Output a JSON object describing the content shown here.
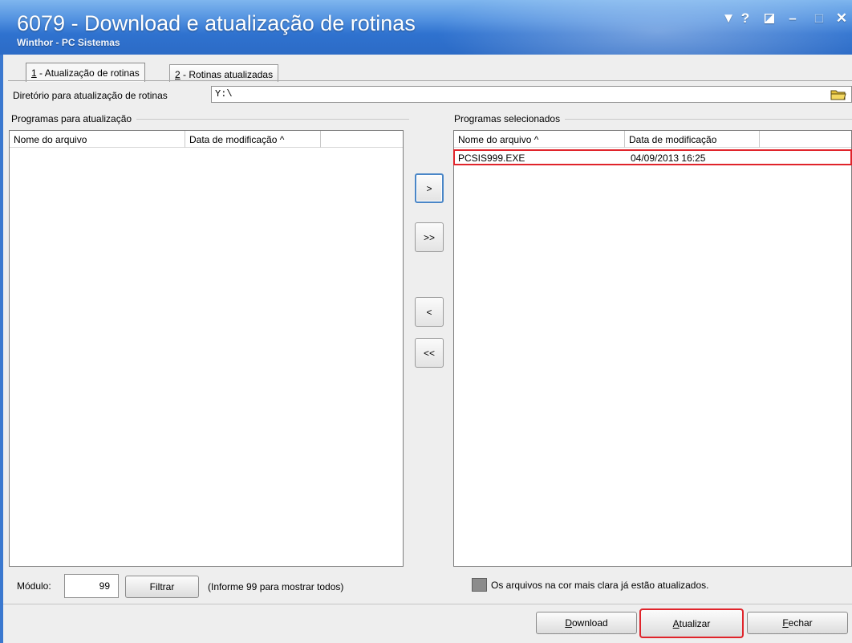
{
  "window": {
    "title": "6079 - Download e atualização de rotinas",
    "subtitle": "Winthor - PC Sistemas",
    "controls": [
      "▼",
      "?",
      "◪",
      "–",
      "□",
      "✕"
    ]
  },
  "tabs": [
    {
      "key": "1",
      "label": " - Atualização de rotinas",
      "active": true
    },
    {
      "key": "2",
      "label": " - Rotinas atualizadas",
      "active": false
    }
  ],
  "directory": {
    "label": "Diretório para atualização de rotinas",
    "value": "Y:\\"
  },
  "left_panel": {
    "title": "Programas para atualização",
    "columns": [
      "Nome do arquivo",
      "Data de modificação ^"
    ],
    "rows": []
  },
  "right_panel": {
    "title": "Programas selecionados",
    "columns": [
      "Nome do arquivo ^",
      "Data de modificação"
    ],
    "rows": [
      {
        "name": "PCSIS999.EXE",
        "date": "04/09/2013 16:25"
      }
    ]
  },
  "move_buttons": {
    "add": ">",
    "add_all": ">>",
    "remove": "<",
    "remove_all": "<<"
  },
  "module": {
    "label": "Módulo:",
    "value": "99",
    "filter_button": "Filtrar",
    "hint": "(Informe 99 para mostrar todos)"
  },
  "legend": {
    "text": "Os arquivos na cor mais clara já estão atualizados."
  },
  "buttons": {
    "download": {
      "mnemonic": "D",
      "rest": "ownload"
    },
    "atualizar": {
      "mnemonic": "A",
      "rest": "tualizar"
    },
    "fechar": {
      "mnemonic": "F",
      "rest": "echar"
    }
  },
  "colors": {
    "title_bar": "#2f72cf",
    "highlight": "#e0242b",
    "legend_swatch": "#8c8c8c"
  }
}
